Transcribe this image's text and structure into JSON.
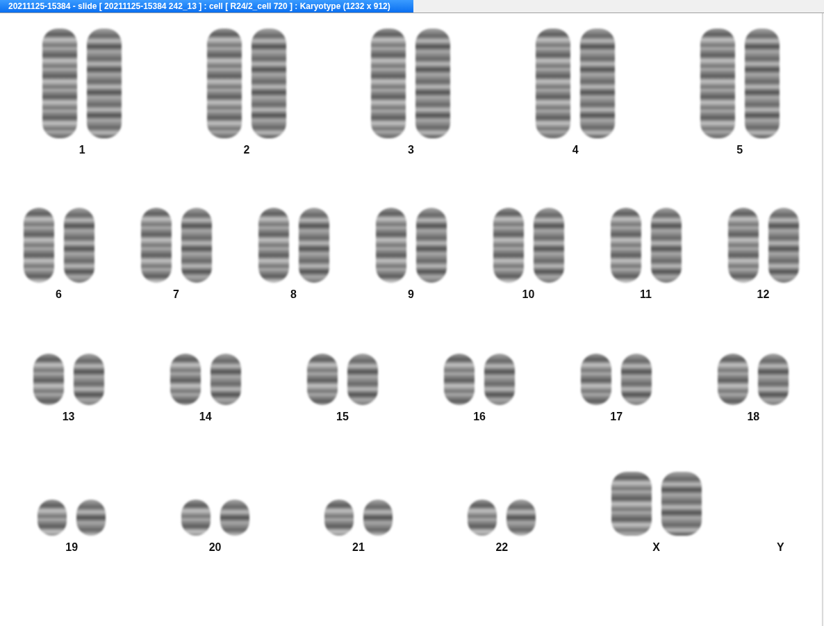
{
  "window": {
    "title": "20211125-15384 - slide [ 20211125-15384 242_13 ] : cell [ R24/2_cell 720 ] : Karyotype  (1232 x 912)"
  },
  "karyotype": {
    "rows": [
      {
        "pairs": [
          {
            "label": "1",
            "kind": "autosome",
            "present": true
          },
          {
            "label": "2",
            "kind": "autosome",
            "present": true
          },
          {
            "label": "3",
            "kind": "autosome",
            "present": true
          },
          {
            "label": "4",
            "kind": "autosome",
            "present": true
          },
          {
            "label": "5",
            "kind": "autosome",
            "present": true
          }
        ]
      },
      {
        "pairs": [
          {
            "label": "6",
            "kind": "autosome",
            "present": true
          },
          {
            "label": "7",
            "kind": "autosome",
            "present": true
          },
          {
            "label": "8",
            "kind": "autosome",
            "present": true
          },
          {
            "label": "9",
            "kind": "autosome",
            "present": true
          },
          {
            "label": "10",
            "kind": "autosome",
            "present": true
          },
          {
            "label": "11",
            "kind": "autosome",
            "present": true
          },
          {
            "label": "12",
            "kind": "autosome",
            "present": true
          }
        ]
      },
      {
        "pairs": [
          {
            "label": "13",
            "kind": "autosome",
            "present": true
          },
          {
            "label": "14",
            "kind": "autosome",
            "present": true
          },
          {
            "label": "15",
            "kind": "autosome",
            "present": true
          },
          {
            "label": "16",
            "kind": "autosome",
            "present": true
          },
          {
            "label": "17",
            "kind": "autosome",
            "present": true
          },
          {
            "label": "18",
            "kind": "autosome",
            "present": true
          }
        ]
      },
      {
        "pairs": [
          {
            "label": "19",
            "kind": "autosome",
            "present": true
          },
          {
            "label": "20",
            "kind": "autosome",
            "present": true
          },
          {
            "label": "21",
            "kind": "autosome",
            "present": true
          },
          {
            "label": "22",
            "kind": "autosome",
            "present": true
          },
          {
            "label": "X",
            "kind": "sex",
            "present": true
          },
          {
            "label": "Y",
            "present": false
          }
        ]
      }
    ]
  }
}
